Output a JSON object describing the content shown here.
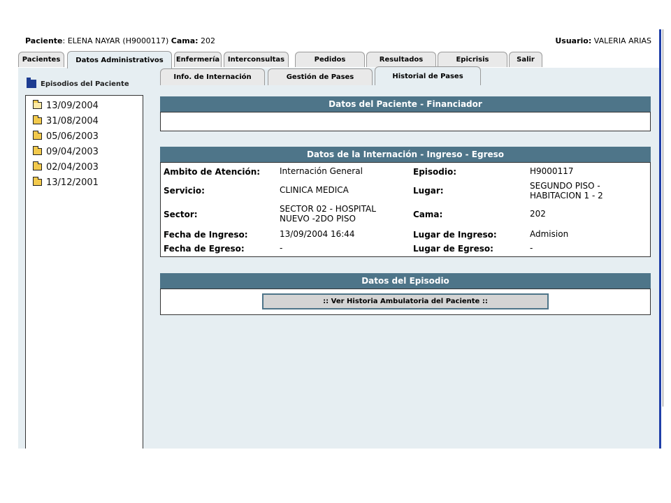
{
  "header": {
    "patient_label": "Paciente",
    "patient_value": ": ELENA NAYAR  (H9000117)",
    "bed_label": "Cama:",
    "bed_value": " 202",
    "user_label": "Usuario:",
    "user_value": " VALERIA ARIAS"
  },
  "main_tabs": [
    {
      "label": "Pacientes"
    },
    {
      "label": "Datos Administrativos"
    },
    {
      "label": "Enfermería"
    },
    {
      "label": "Interconsultas"
    },
    {
      "label": "Pedidos"
    },
    {
      "label": "Resultados"
    },
    {
      "label": "Epicrisis"
    },
    {
      "label": "Salir"
    }
  ],
  "sub_tabs": [
    {
      "label": "Info. de Internación"
    },
    {
      "label": "Gestión de Pases"
    },
    {
      "label": "Historial de Pases"
    }
  ],
  "episodes": {
    "title": "Episodios del Paciente",
    "items": [
      "13/09/2004",
      "31/08/2004",
      "05/06/2003",
      "09/04/2003",
      "02/04/2003",
      "13/12/2001"
    ]
  },
  "financiador": {
    "title": "Datos del Paciente - Financiador"
  },
  "internacion": {
    "title": "Datos de la Internación - Ingreso - Egreso",
    "ambito_label": "Ambito de Atención:",
    "ambito_value": "Internación General",
    "episodio_label": "Episodio:",
    "episodio_value": "H9000117",
    "servicio_label": "Servicio:",
    "servicio_value": "CLINICA MEDICA",
    "lugar_label": "Lugar:",
    "lugar_value_1": "SEGUNDO PISO -",
    "lugar_value_2": "HABITACION 1 - 2",
    "sector_label": "Sector:",
    "sector_value_1": "SECTOR 02 - HOSPITAL",
    "sector_value_2": "NUEVO -2DO PISO",
    "cama_label": "Cama:",
    "cama_value": "202",
    "fecha_ingreso_label": "Fecha de Ingreso:",
    "fecha_ingreso_value": "13/09/2004 16:44",
    "lugar_ingreso_label": "Lugar de Ingreso:",
    "lugar_ingreso_value": "Admision",
    "fecha_egreso_label": "Fecha de Egreso:",
    "fecha_egreso_value": "-",
    "lugar_egreso_label": "Lugar de Egreso:",
    "lugar_egreso_value": "-"
  },
  "episodio": {
    "title": "Datos del Episodio",
    "button_label": ":: Ver Historia Ambulatoria del Paciente ::"
  },
  "colors": {
    "section_header": "#4e7589",
    "content_bg": "#e6eef2",
    "frame_border": "#1f3fa8"
  }
}
